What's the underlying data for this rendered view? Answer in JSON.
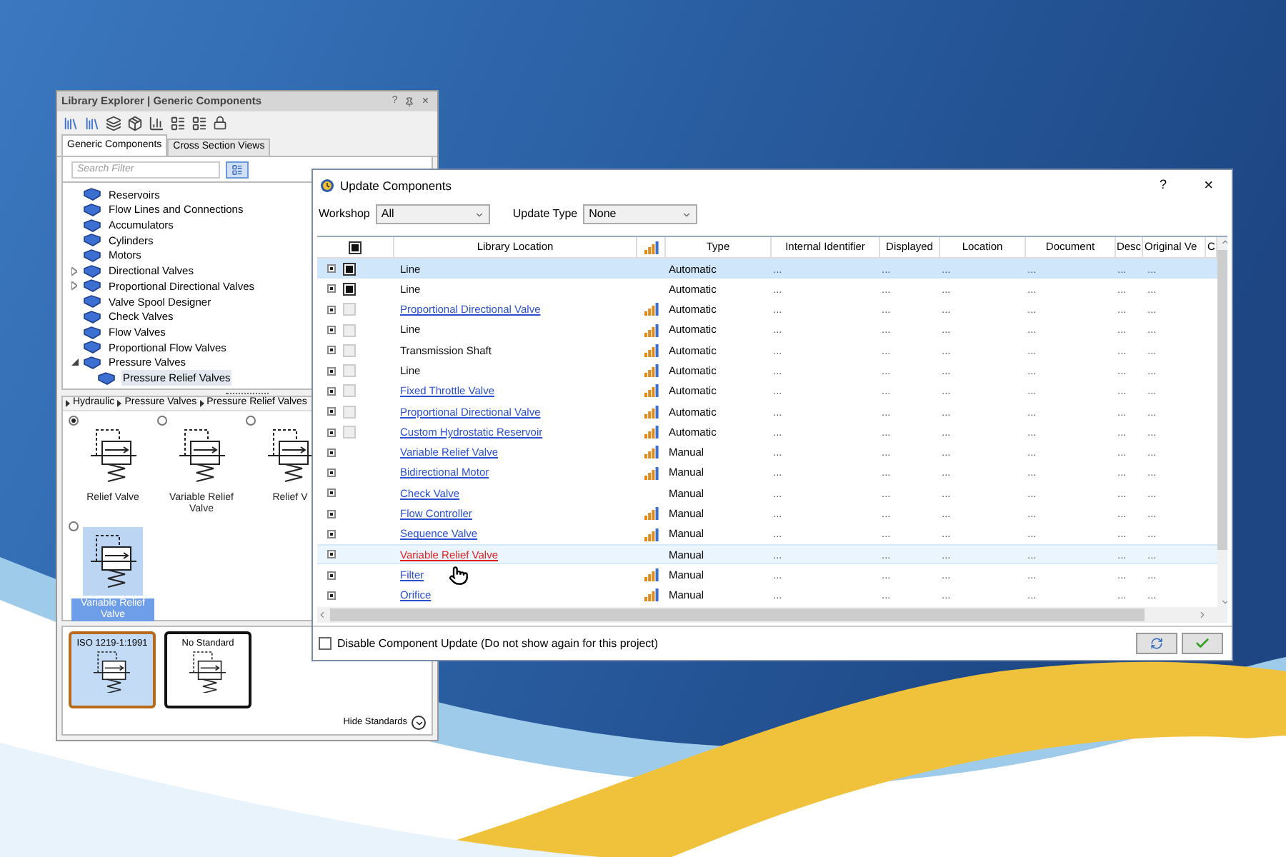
{
  "explorer": {
    "title": "Library Explorer | Generic Components",
    "title_buttons": [
      "?",
      "×"
    ],
    "tabs": [
      {
        "label": "Generic Components",
        "selected": true
      },
      {
        "label": "Cross Section Views",
        "selected": false
      }
    ],
    "search": {
      "placeholder": "Search Filter"
    },
    "tree": [
      {
        "label": "Reservoirs",
        "selected": false
      },
      {
        "label": "Flow Lines and Connections",
        "selected": false
      },
      {
        "label": "Accumulators",
        "selected": false
      },
      {
        "label": "Cylinders",
        "selected": false
      },
      {
        "label": "Motors",
        "selected": false
      },
      {
        "label": "Directional Valves",
        "selected": false,
        "expanded": false
      },
      {
        "label": "Proportional Directional Valves",
        "selected": false,
        "expanded": false
      },
      {
        "label": "Valve Spool Designer",
        "selected": false
      },
      {
        "label": "Check Valves",
        "selected": false
      },
      {
        "label": "Flow Valves",
        "selected": false
      },
      {
        "label": "Proportional Flow Valves",
        "selected": false
      },
      {
        "label": "Pressure Valves",
        "selected": false,
        "expanded": true,
        "children": [
          {
            "label": "Pressure Relief Valves",
            "selected": true
          }
        ]
      }
    ],
    "breadcrumb": [
      "Hydraulic",
      "Pressure Valves",
      "Pressure Relief Valves"
    ],
    "symbols": [
      {
        "label": "Relief Valve",
        "checked": true,
        "selected": false
      },
      {
        "label": "Variable Relief Valve",
        "checked": false,
        "selected": false
      },
      {
        "label": "Relief V",
        "checked": false,
        "selected": false
      },
      {
        "label": "Variable Relief Valve",
        "checked": false,
        "selected": true
      }
    ],
    "standards": [
      {
        "label": "ISO 1219-1:1991",
        "selected": true
      },
      {
        "label": "No Standard",
        "selected": false
      }
    ],
    "hide_standards": "Hide Standards"
  },
  "dialog": {
    "title": "Update Components",
    "title_buttons": [
      "?",
      "×"
    ],
    "filters": [
      {
        "label": "Workshop",
        "value": "All"
      },
      {
        "label": "Update Type",
        "value": "None"
      }
    ],
    "header_checked": true,
    "columns": [
      "Library Location",
      "Type",
      "Internal Identifier",
      "Displayed",
      "Location",
      "Document",
      "Desc",
      "Original Ve",
      "C"
    ],
    "rows": [
      {
        "name": "Line",
        "has_checkbox": true,
        "checked": true,
        "link": false,
        "bars": false,
        "type": "Automatic",
        "selected": true,
        "hovered": false,
        "cells": [
          "...",
          "...",
          "...",
          "...",
          "...",
          "..."
        ]
      },
      {
        "name": "Line",
        "has_checkbox": true,
        "checked": true,
        "link": false,
        "bars": false,
        "type": "Automatic",
        "selected": false,
        "hovered": false,
        "cells": [
          "...",
          "...",
          "...",
          "...",
          "...",
          "..."
        ]
      },
      {
        "name": "Proportional Directional Valve",
        "has_checkbox": true,
        "checked": false,
        "link": true,
        "bars": true,
        "type": "Automatic",
        "selected": false,
        "hovered": false,
        "cells": [
          "...",
          "...",
          "...",
          "...",
          "...",
          "..."
        ]
      },
      {
        "name": "Line",
        "has_checkbox": true,
        "checked": false,
        "link": false,
        "bars": true,
        "type": "Automatic",
        "selected": false,
        "hovered": false,
        "cells": [
          "...",
          "...",
          "...",
          "...",
          "...",
          "..."
        ]
      },
      {
        "name": "Transmission Shaft",
        "has_checkbox": true,
        "checked": false,
        "link": false,
        "bars": true,
        "type": "Automatic",
        "selected": false,
        "hovered": false,
        "cells": [
          "...",
          "...",
          "...",
          "...",
          "...",
          "..."
        ]
      },
      {
        "name": "Line",
        "has_checkbox": true,
        "checked": false,
        "link": false,
        "bars": true,
        "type": "Automatic",
        "selected": false,
        "hovered": false,
        "cells": [
          "...",
          "...",
          "...",
          "...",
          "...",
          "..."
        ]
      },
      {
        "name": "Fixed Throttle Valve",
        "has_checkbox": true,
        "checked": false,
        "link": true,
        "bars": true,
        "type": "Automatic",
        "selected": false,
        "hovered": false,
        "cells": [
          "...",
          "...",
          "...",
          "...",
          "...",
          "..."
        ]
      },
      {
        "name": "Proportional Directional Valve",
        "has_checkbox": true,
        "checked": false,
        "link": true,
        "bars": true,
        "type": "Automatic",
        "selected": false,
        "hovered": false,
        "cells": [
          "...",
          "...",
          "...",
          "...",
          "...",
          "..."
        ]
      },
      {
        "name": "Custom Hydrostatic Reservoir",
        "has_checkbox": true,
        "checked": false,
        "link": true,
        "bars": true,
        "type": "Automatic",
        "selected": false,
        "hovered": false,
        "cells": [
          "...",
          "...",
          "...",
          "...",
          "...",
          "..."
        ]
      },
      {
        "name": "Variable Relief Valve",
        "has_checkbox": false,
        "link": true,
        "bars": true,
        "type": "Manual",
        "selected": false,
        "hovered": false,
        "cells": [
          "...",
          "...",
          "...",
          "...",
          "...",
          "..."
        ]
      },
      {
        "name": "Bidirectional Motor",
        "has_checkbox": false,
        "link": true,
        "bars": true,
        "type": "Manual",
        "selected": false,
        "hovered": false,
        "cells": [
          "...",
          "...",
          "...",
          "...",
          "...",
          "..."
        ]
      },
      {
        "name": "Check Valve",
        "has_checkbox": false,
        "link": true,
        "bars": false,
        "type": "Manual",
        "selected": false,
        "hovered": false,
        "cells": [
          "...",
          "...",
          "...",
          "...",
          "...",
          "..."
        ]
      },
      {
        "name": "Flow Controller",
        "has_checkbox": false,
        "link": true,
        "bars": true,
        "type": "Manual",
        "selected": false,
        "hovered": false,
        "cells": [
          "...",
          "...",
          "...",
          "...",
          "...",
          "..."
        ]
      },
      {
        "name": "Sequence Valve",
        "has_checkbox": false,
        "link": true,
        "bars": true,
        "type": "Manual",
        "selected": false,
        "hovered": false,
        "cells": [
          "...",
          "...",
          "...",
          "...",
          "...",
          "..."
        ]
      },
      {
        "name": "Variable Relief Valve",
        "has_checkbox": false,
        "link": true,
        "bars": false,
        "type": "Manual",
        "selected": false,
        "hovered": true,
        "cells": [
          "...",
          "...",
          "...",
          "...",
          "...",
          "..."
        ]
      },
      {
        "name": "Filter",
        "has_checkbox": false,
        "link": true,
        "bars": true,
        "type": "Manual",
        "selected": false,
        "hovered": false,
        "cells": [
          "...",
          "...",
          "...",
          "...",
          "...",
          "..."
        ]
      },
      {
        "name": "Orifice",
        "has_checkbox": false,
        "link": true,
        "bars": true,
        "type": "Manual",
        "selected": false,
        "hovered": false,
        "cells": [
          "...",
          "...",
          "...",
          "...",
          "...",
          "..."
        ]
      }
    ],
    "disable_update": {
      "label": "Disable Component Update (Do not show again for this project)",
      "checked": false
    }
  }
}
